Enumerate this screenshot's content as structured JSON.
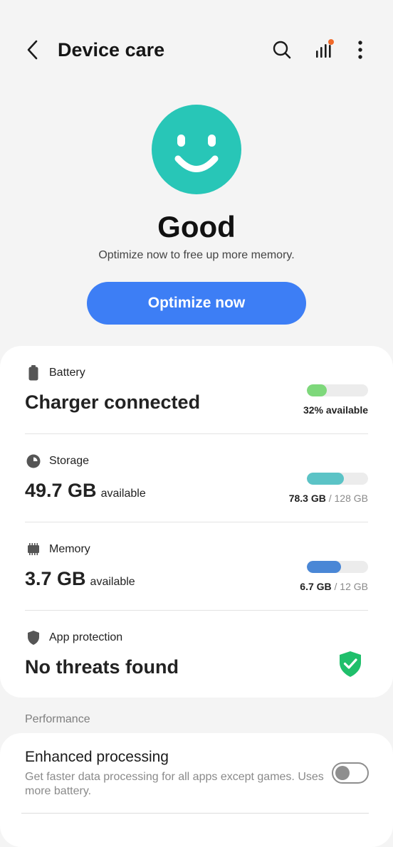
{
  "header": {
    "title": "Device care"
  },
  "status": {
    "word": "Good",
    "message": "Optimize now to free up more memory.",
    "face_color": "#28c6b7"
  },
  "actions": {
    "optimize_label": "Optimize now"
  },
  "battery": {
    "label": "Battery",
    "value": "Charger connected",
    "level_percent": 32,
    "caption": "32% available",
    "bar_color": "#7ed87b"
  },
  "storage": {
    "label": "Storage",
    "value": "49.7 GB",
    "unit_text": "available",
    "used": "78.3 GB",
    "total": "/ 128 GB",
    "used_fraction": 0.61,
    "bar_color": "#5bc3c6"
  },
  "memory": {
    "label": "Memory",
    "value": "3.7 GB",
    "unit_text": "available",
    "used": "6.7 GB",
    "total": "/ 12 GB",
    "used_fraction": 0.56,
    "bar_color": "#4a87d6"
  },
  "protection": {
    "label": "App protection",
    "value": "No threats found",
    "shield_color": "#1fbf6b"
  },
  "performance": {
    "group_label": "Performance",
    "setting_title": "Enhanced processing",
    "setting_desc": "Get faster data processing for all apps except games. Uses more battery.",
    "enabled": false
  },
  "icons": {
    "back": "chevron-left-icon",
    "search": "search-icon",
    "stats": "signal-bars-icon",
    "more": "more-vertical-icon",
    "badge_color": "#f16a2a"
  }
}
